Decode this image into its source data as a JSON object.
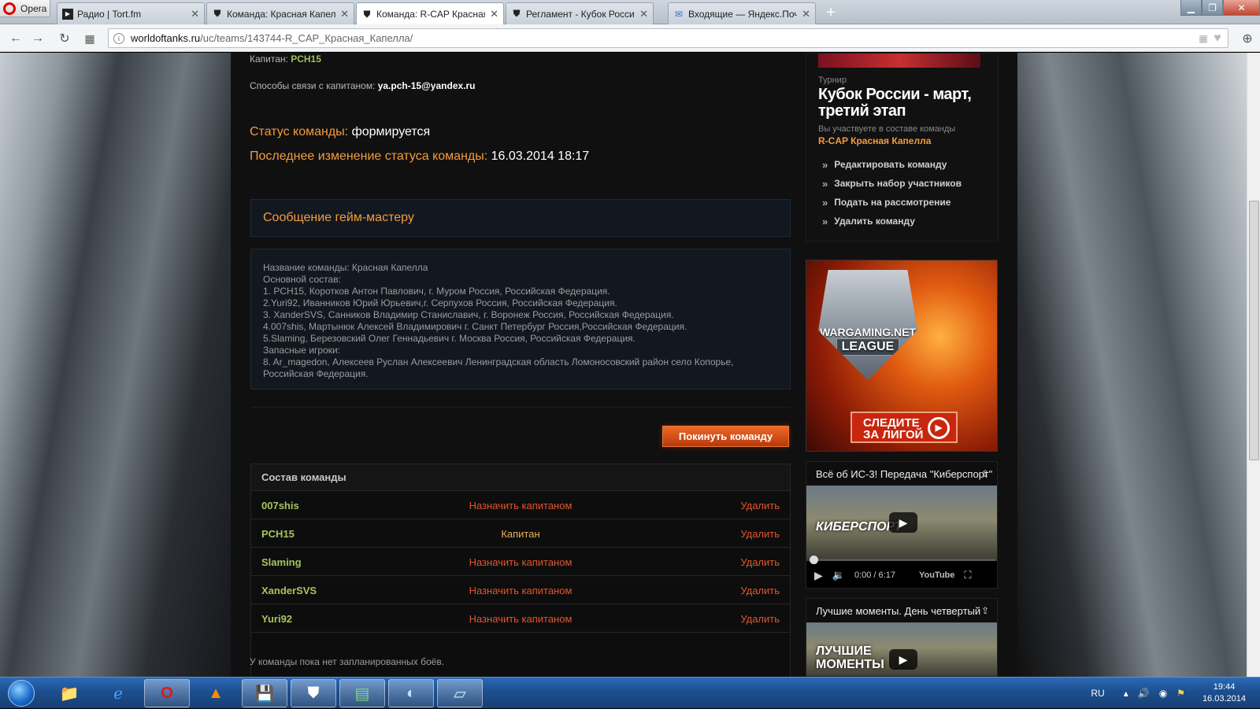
{
  "browser": {
    "app_label": "Opera",
    "tabs": [
      {
        "title": "Радио | Tort.fm",
        "active": false
      },
      {
        "title": "Команда: Красная Капелла",
        "active": false
      },
      {
        "title": "Команда: R-CAP Красная Капелла",
        "active": true
      },
      {
        "title": "Регламент - Кубок России",
        "active": false
      },
      {
        "title": "Входящие — Яндекс.Почта",
        "active": false
      }
    ],
    "new_tab": "+",
    "url_host": "worldoftanks.ru",
    "url_path": "/uc/teams/143744-R_CAP_Красная_Капелла/"
  },
  "team": {
    "captain_label": "Капитан:",
    "captain_name": "PCH15",
    "contact_label": "Способы связи с капитаном:",
    "contact_value": "ya.pch-15@yandex.ru",
    "status_label": "Статус команды:",
    "status_value": "формируется",
    "last_change_label": "Последнее изменение статуса команды:",
    "last_change_value": "16.03.2014 18:17"
  },
  "gm_message": {
    "title": "Сообщение гейм-мастеру",
    "lines": [
      "Название команды: Красная Капелла",
      "Основной состав:",
      "1. PCH15, Коротков Антон Павлович, г. Муром Россия, Российская Федерация.",
      "2.Yuri92, Иванников Юрий Юрьевич,г. Серпухов Россия, Российская Федерация.",
      "3. XanderSVS, Санников Владимир Станиславич, г. Воронеж Россия, Российская Федерация.",
      "4.007shis, Мартынюк Алексей Владимирович г. Санкт Петербург Россия,Российская Федерация.",
      "5.Slaming, Березовский Олег Геннадьевич г. Москва Россия, Российская Федерация.",
      "Запасные игроки:",
      "8. Ar_magedon, Алексеев Руслан Алексеевич Ленинградская область Ломоносовский район село Копорье, Российская Федерация."
    ]
  },
  "leave_button": "Покинуть команду",
  "roster": {
    "title": "Состав команды",
    "rows": [
      {
        "name": "007shis",
        "action": "Назначить капитаном",
        "delete": "Удалить"
      },
      {
        "name": "PCH15",
        "action": "Капитан",
        "delete": "Удалить"
      },
      {
        "name": "Slaming",
        "action": "Назначить капитаном",
        "delete": "Удалить"
      },
      {
        "name": "XanderSVS",
        "action": "Назначить капитаном",
        "delete": "Удалить"
      },
      {
        "name": "Yuri92",
        "action": "Назначить капитаном",
        "delete": "Удалить"
      }
    ]
  },
  "no_battles": "У команды пока нет запланированных боёв.",
  "tournament": {
    "kicker": "Турнир",
    "title": "Кубок России - март, третий этап",
    "participating": "Вы участвуете в составе команды",
    "team_name": "R-CAP Красная Капелла",
    "actions": [
      "Редактировать команду",
      "Закрыть набор участников",
      "Подать на рассмотрение",
      "Удалить команду"
    ]
  },
  "banner": {
    "brand_line1": "WARGAMING.NET",
    "brand_line2": "LEAGUE",
    "cta": "СЛЕДИТЕ ЗА ЛИГОЙ"
  },
  "videos": [
    {
      "title": "Всё об ИС-3! Передача \"Киберспорт\"",
      "overlay": "КИБЕРСПОРТ",
      "time": "0:00 / 6:17",
      "provider": "YouTube"
    },
    {
      "title": "Лучшие моменты. День четвертый",
      "overlay": "ЛУЧШИЕ МОМЕНТЫ"
    }
  ],
  "taskbar": {
    "lang": "RU",
    "time": "19:44",
    "date": "16.03.2014"
  },
  "colors": {
    "accent": "#f59b3e",
    "player_name": "#a7c45c",
    "danger_link": "#e2552c",
    "button": "#d9501a"
  }
}
